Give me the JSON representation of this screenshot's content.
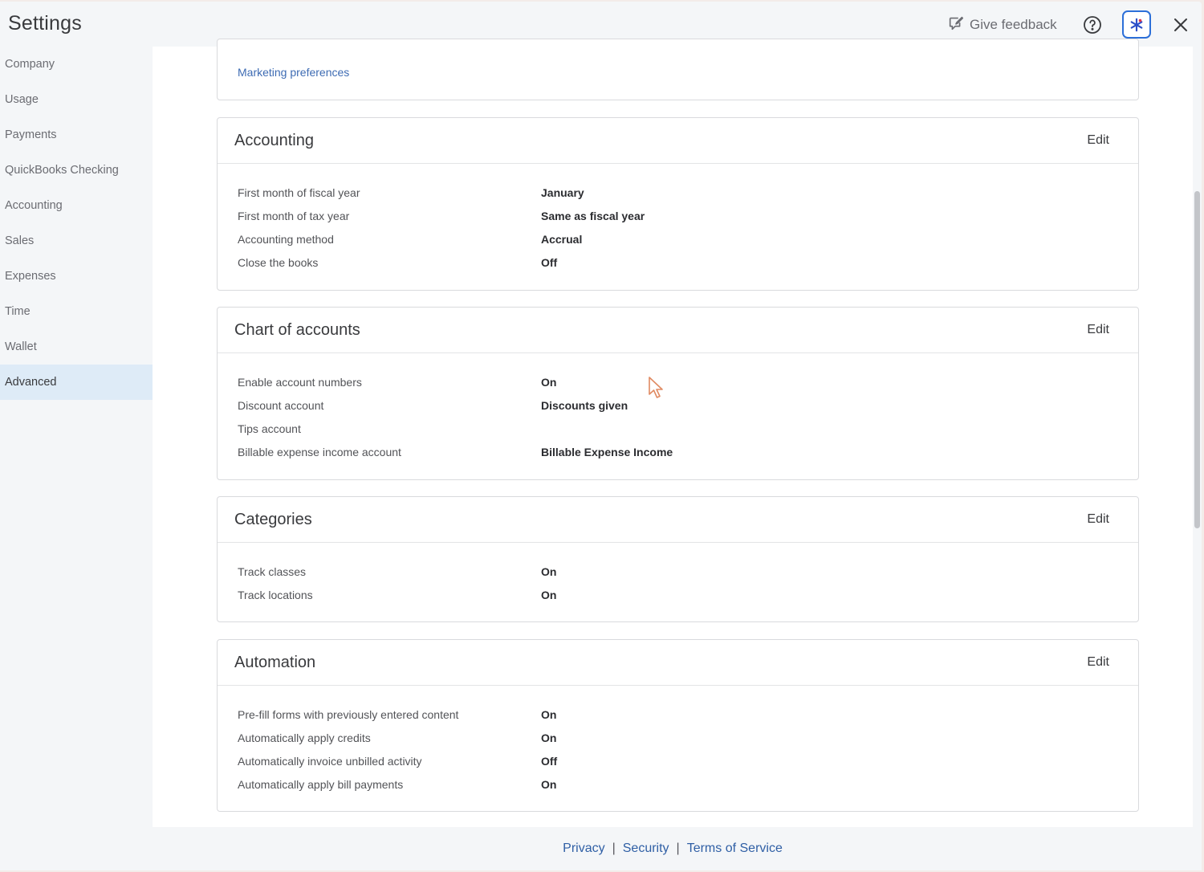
{
  "header": {
    "title": "Settings",
    "feedback_label": "Give feedback"
  },
  "sidebar": {
    "items": [
      {
        "label": "Company"
      },
      {
        "label": "Usage"
      },
      {
        "label": "Payments"
      },
      {
        "label": "QuickBooks Checking"
      },
      {
        "label": "Accounting"
      },
      {
        "label": "Sales"
      },
      {
        "label": "Expenses"
      },
      {
        "label": "Time"
      },
      {
        "label": "Wallet"
      },
      {
        "label": "Advanced",
        "active": true
      }
    ]
  },
  "top_card": {
    "link_label": "Marketing preferences"
  },
  "sections": [
    {
      "title": "Accounting",
      "edit_label": "Edit",
      "rows": [
        {
          "label": "First month of fiscal year",
          "value": "January"
        },
        {
          "label": "First month of tax year",
          "value": "Same as fiscal year"
        },
        {
          "label": "Accounting method",
          "value": "Accrual"
        },
        {
          "label": "Close the books",
          "value": "Off"
        }
      ]
    },
    {
      "title": "Chart of accounts",
      "edit_label": "Edit",
      "rows": [
        {
          "label": "Enable account numbers",
          "value": "On"
        },
        {
          "label": "Discount account",
          "value": "Discounts given"
        },
        {
          "label": "Tips account",
          "value": ""
        },
        {
          "label": "Billable expense income account",
          "value": "Billable Expense Income"
        }
      ]
    },
    {
      "title": "Categories",
      "edit_label": "Edit",
      "rows": [
        {
          "label": "Track classes",
          "value": "On"
        },
        {
          "label": "Track locations",
          "value": "On"
        }
      ]
    },
    {
      "title": "Automation",
      "edit_label": "Edit",
      "rows": [
        {
          "label": "Pre-fill forms with previously entered content",
          "value": "On"
        },
        {
          "label": "Automatically apply credits",
          "value": "On"
        },
        {
          "label": "Automatically invoice unbilled activity",
          "value": "Off"
        },
        {
          "label": "Automatically apply bill payments",
          "value": "On"
        }
      ]
    }
  ],
  "footer": {
    "privacy": "Privacy",
    "security": "Security",
    "terms": "Terms of Service",
    "separator": "|"
  },
  "colors": {
    "link": "#3d6bb3",
    "active_nav": "#deebf7",
    "ai_button_border": "#2c6fd8"
  },
  "icons": {
    "feedback": "feedback-icon",
    "help": "help-icon",
    "ai": "ai-assistant-icon",
    "close": "close-icon"
  }
}
